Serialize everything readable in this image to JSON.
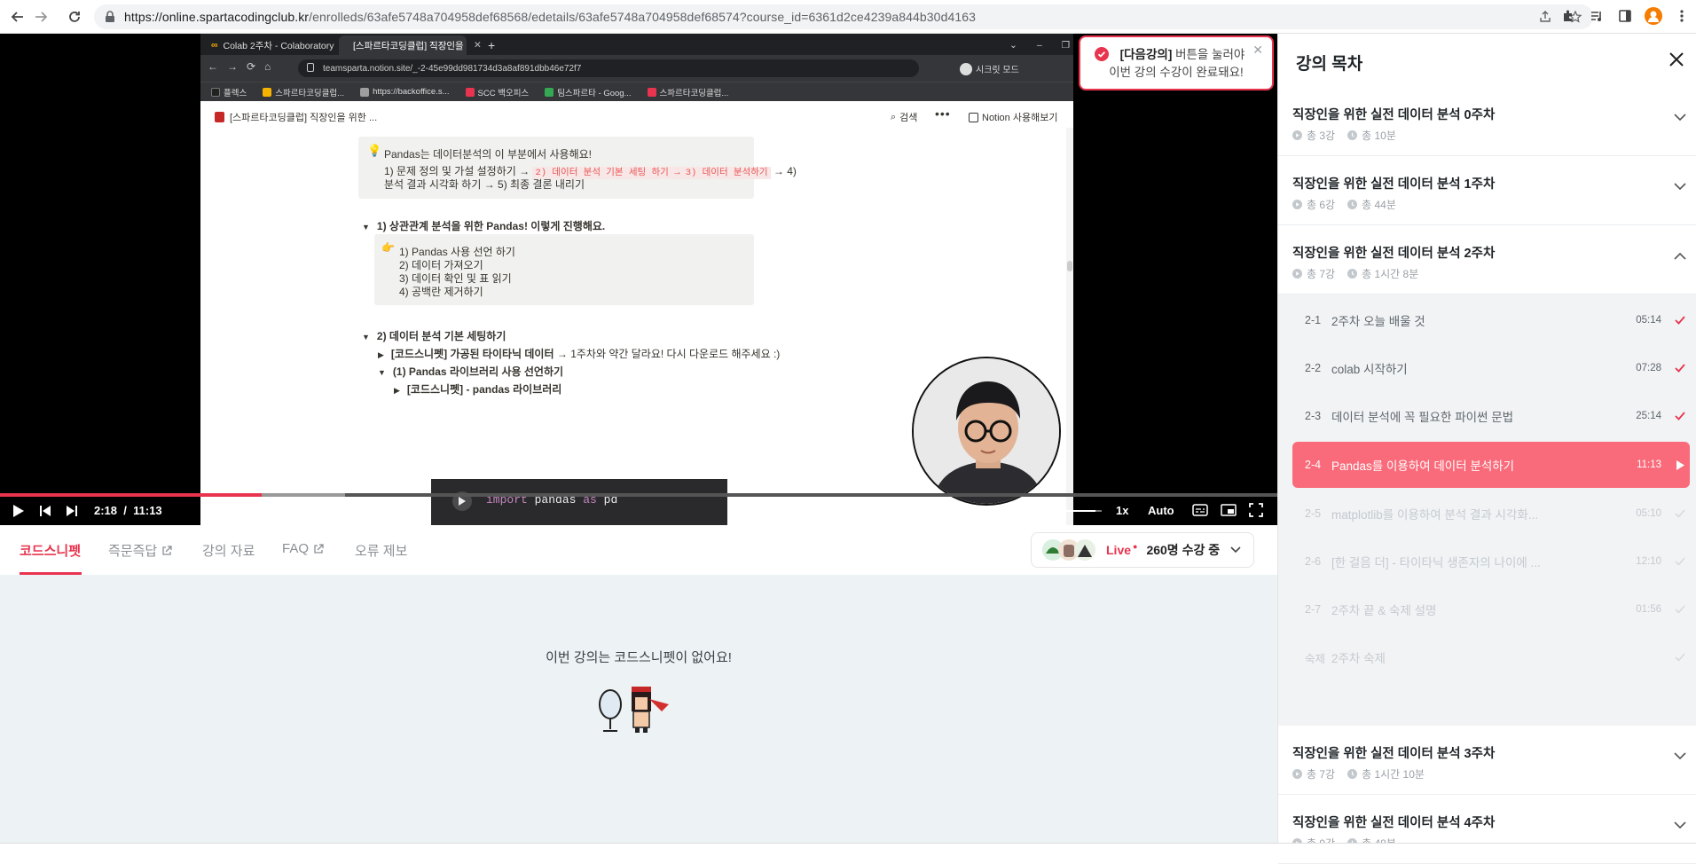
{
  "browser": {
    "url_base": "https://online.spartacodingclub.kr",
    "url_path": "/enrolleds/63afe5748a704958def68568/edetails/63afe5748a704958def68574?course_id=6361d2ce4239a844b30d4163"
  },
  "video": {
    "inner_browser": {
      "tab1": "Colab 2주차 - Colaboratory",
      "tab2": "[스파르타코딩클럽] 직장인을 위",
      "url": "teamsparta.notion.site/_-2-45e99dd981734d3a8af891dbb46e72f7",
      "secret_mode": "시크릿 모드",
      "bookmarks": [
        {
          "label": "플렉스",
          "color": "#222222"
        },
        {
          "label": "스파르타코딩클럽...",
          "color": "#f4b400"
        },
        {
          "label": "https://backoffice.s...",
          "color": "#9e9e9e"
        },
        {
          "label": "SCC 백오피스",
          "color": "#e8344e"
        },
        {
          "label": "팀스파르타 - Goog...",
          "color": "#34a853"
        },
        {
          "label": "스파르타코딩클럽...",
          "color": "#e8344e"
        }
      ]
    },
    "notion": {
      "page_title": "[스파르타코딩클럽] 직장인을 위한 ...",
      "search": "검색",
      "try_notion": "Notion 사용해보기",
      "callout_head": "Pandas는 데이터분석의 이 부분에서 사용해요!",
      "callout_l1_a": "1) 문제 정의 및 가설 설정하기 →",
      "callout_l1_code": "2) 데이터 분석 기본 세팅 하기 → 3) 데이터 분석하기",
      "callout_l1_b": "→ 4)",
      "callout_l2": "분석 결과 시각화 하기 → 5) 최종 결론 내리기",
      "toggle1": "1) 상관관계 분석을 위한 Pandas! 이렇게 진행해요.",
      "steps": [
        "1) Pandas 사용 선언 하기",
        "2) 데이터 가져오기",
        "3) 데이터 확인 및 표 읽기",
        "4) 공백란 제거하기"
      ],
      "toggle2": "2) 데이터 분석 기본 세팅하기",
      "sub1_bold": "[코드스니펫] 가공된 타이타닉 데이터",
      "sub1_rest": "→ 1주차와 약간 달라요! 다시 다운로드 해주세요 :)",
      "sub2": "(1) Pandas 라이브러리 사용 선언하기",
      "sub3": "[코드스니펫] - pandas 라이브러리",
      "code_kw1": "import",
      "code_mid": " pandas ",
      "code_kw2": "as",
      "code_end": " pd"
    },
    "controls": {
      "current_time": "2:18",
      "separator": "/",
      "duration": "11:13",
      "progress": 0.205,
      "buffered": 0.27,
      "volume": 0.9,
      "speed": "1x",
      "quality": "Auto"
    }
  },
  "below_tabs": [
    {
      "label": "코드스니펫",
      "active": true,
      "external": false
    },
    {
      "label": "즉문즉답",
      "active": false,
      "external": true
    },
    {
      "label": "강의 자료",
      "active": false,
      "external": false
    },
    {
      "label": "FAQ",
      "active": false,
      "external": true
    },
    {
      "label": "오류 제보",
      "active": false,
      "external": false
    }
  ],
  "live": {
    "label": "Live",
    "count": "260명 수강 중"
  },
  "snippet_empty_msg": "이번 강의는 코드스니펫이 없어요!",
  "toast": {
    "bold": "[다음강의]",
    "line1_rest": " 버튼을 눌러야",
    "line2": "이번 강의 수강이 완료돼요!"
  },
  "panel": {
    "title": "강의 목차",
    "weeks": [
      {
        "title": "직장인을 위한 실전 데이터 분석 0주차",
        "count": "총 3강",
        "time": "총 10분",
        "expanded": false
      },
      {
        "title": "직장인을 위한 실전 데이터 분석 1주차",
        "count": "총 6강",
        "time": "총 44분",
        "expanded": false
      },
      {
        "title": "직장인을 위한 실전 데이터 분석 2주차",
        "count": "총 7강",
        "time": "총 1시간 8분",
        "expanded": true
      },
      {
        "title": "직장인을 위한 실전 데이터 분석 3주차",
        "count": "총 7강",
        "time": "총 1시간 10분",
        "expanded": false
      },
      {
        "title": "직장인을 위한 실전 데이터 분석 4주차",
        "count": "총 9강",
        "time": "총 48분",
        "expanded": false
      }
    ],
    "lessons": [
      {
        "num": "2-1",
        "title": "2주차 오늘 배울 것",
        "dur": "05:14",
        "state": "done"
      },
      {
        "num": "2-2",
        "title": "colab 시작하기",
        "dur": "07:28",
        "state": "done"
      },
      {
        "num": "2-3",
        "title": "데이터 분석에 꼭 필요한 파이썬 문법",
        "dur": "25:14",
        "state": "done"
      },
      {
        "num": "2-4",
        "title": "Pandas를 이용하여 데이터 분석하기",
        "dur": "11:13",
        "state": "active"
      },
      {
        "num": "2-5",
        "title": "matplotlib를 이용하여 분석 결과 시각화...",
        "dur": "05:10",
        "state": "todo"
      },
      {
        "num": "2-6",
        "title": "[한 걸음 더] - 타이타닉 생존자의 나이에 ...",
        "dur": "12:10",
        "state": "todo"
      },
      {
        "num": "2-7",
        "title": "2주차 끝 & 숙제 설명",
        "dur": "01:56",
        "state": "todo"
      },
      {
        "num": "숙제",
        "title": "2주차 숙제",
        "dur": "",
        "state": "todo"
      }
    ]
  },
  "colors": {
    "accent": "#e8344e",
    "active_lesson_bg": "#f96b7a",
    "snippet_bg": "#edf2f4"
  }
}
